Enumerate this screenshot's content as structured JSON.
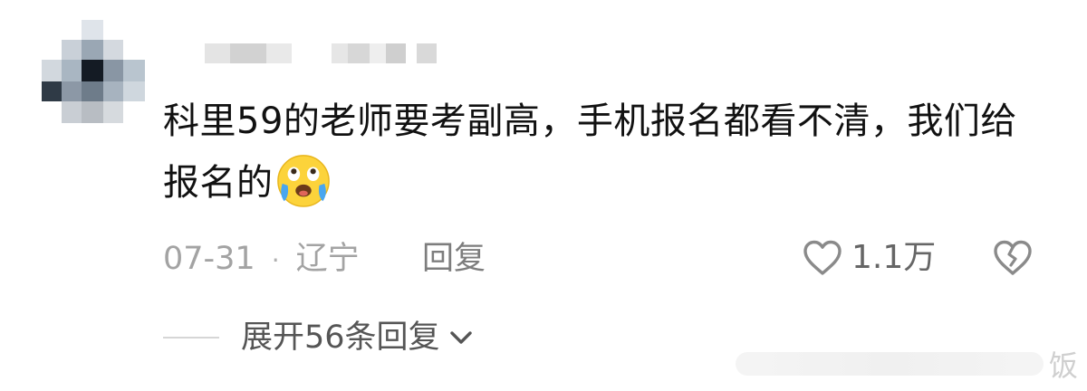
{
  "comment": {
    "text": "科里59的老师要考副高，手机报名都看不清，我们给报名的",
    "emoji": "crying-emoji",
    "date": "07-31",
    "separator": "·",
    "location": "辽宁",
    "reply_label": "回复",
    "like_count": "1.1万"
  },
  "replies": {
    "expand_label": "展开56条回复"
  },
  "watermark": {
    "char": "饭"
  },
  "colors": {
    "text": "#111111",
    "meta": "#a3a3a3",
    "icon": "#8a8a8a"
  }
}
